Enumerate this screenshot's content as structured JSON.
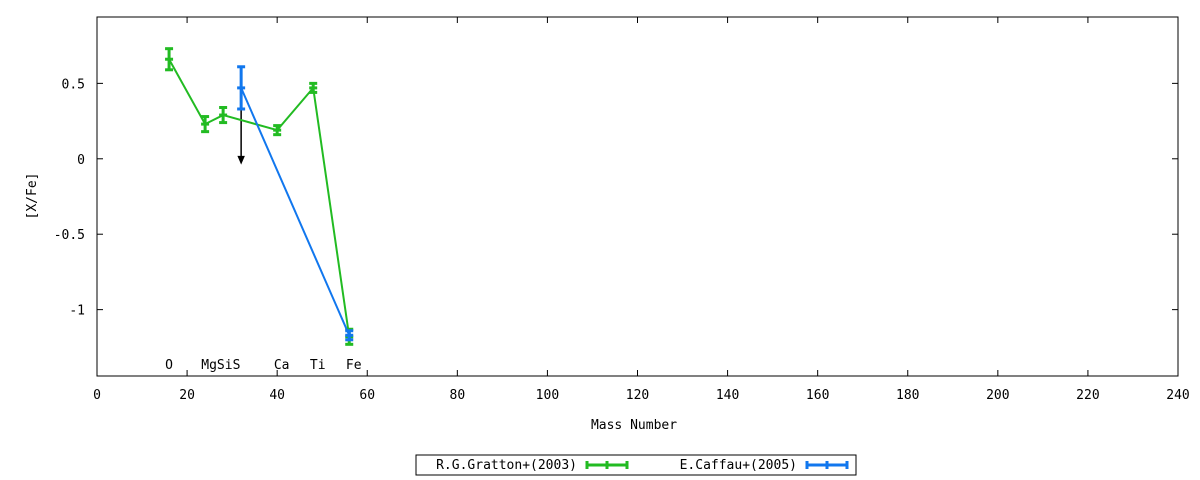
{
  "chart_data": {
    "type": "line",
    "xlabel": "Mass Number",
    "ylabel": "[X/Fe]",
    "xlim": [
      0,
      240
    ],
    "ylim": [
      -1.44,
      0.94
    ],
    "x_ticks": [
      0,
      20,
      40,
      60,
      80,
      100,
      120,
      140,
      160,
      180,
      200,
      220,
      240
    ],
    "y_ticks": [
      {
        "value": 0.5,
        "label": "0.5"
      },
      {
        "value": 0,
        "label": "0"
      },
      {
        "value": -0.5,
        "label": "-0.5"
      },
      {
        "value": -1,
        "label": "-1"
      }
    ],
    "element_labels": [
      {
        "text": "O",
        "x": 16
      },
      {
        "text": "MgSiS",
        "x": 27.5
      },
      {
        "text": "Ca",
        "x": 41
      },
      {
        "text": "Ti",
        "x": 49
      },
      {
        "text": "Fe",
        "x": 57
      }
    ],
    "series": [
      {
        "name": "R.G.Gratton+(2003)",
        "color": "#22bb22",
        "points": [
          {
            "x": 16,
            "y": 0.66,
            "err": 0.07
          },
          {
            "x": 24,
            "y": 0.23,
            "err": 0.05
          },
          {
            "x": 28,
            "y": 0.29,
            "err": 0.05
          },
          {
            "x": 40,
            "y": 0.19,
            "err": 0.03
          },
          {
            "x": 48,
            "y": 0.47,
            "err": 0.03
          },
          {
            "x": 56,
            "y": -1.18,
            "err": 0.05
          }
        ]
      },
      {
        "name": "E.Caffau+(2005)",
        "color": "#1177ee",
        "points": [
          {
            "x": 32,
            "y": 0.47,
            "err": 0.14
          },
          {
            "x": 56,
            "y": -1.17,
            "err": 0.03
          }
        ]
      }
    ],
    "upper_limit_arrows": [
      {
        "x": 32,
        "y_from": 0.47,
        "y_to": -0.03,
        "color": "#000000"
      }
    ],
    "legend_position": "bottom-center"
  }
}
